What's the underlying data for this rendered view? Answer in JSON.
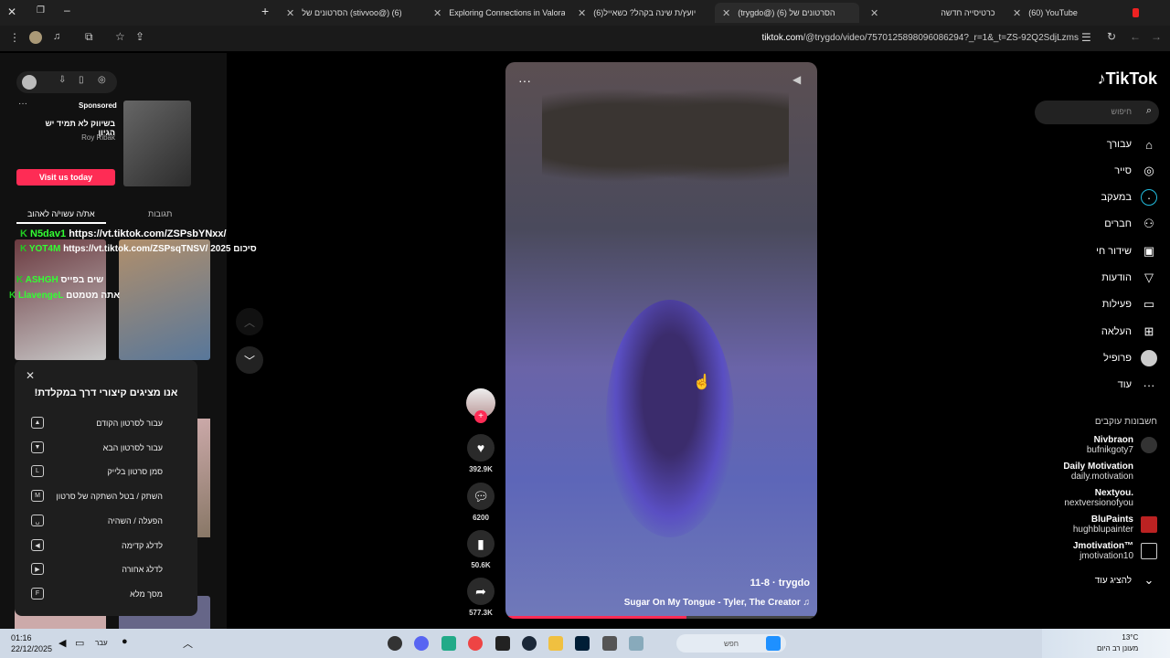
{
  "tabs": [
    {
      "label": "(60) YouTube",
      "color": "#e22"
    },
    {
      "label": "כרטיסייה חדשה",
      "color": "#fff"
    },
    {
      "label": "(trygdo@) הסרטונים של (6)",
      "color": "#111"
    },
    {
      "label": "(6)יועץ/ת שינה בקהל? כשאייל",
      "color": "#111"
    },
    {
      "label": "Exploring Connections in Valorant",
      "color": "#111"
    },
    {
      "label": "הסרטונים של (stivvoo@) (6)",
      "color": "#111"
    }
  ],
  "address": {
    "host": "tiktok.com",
    "path": "/@trygdo/video/7570125898096086294?_r=1&_t=ZS-92Q2SdjLzms"
  },
  "left_panel": {
    "sponsored": "Sponsored",
    "ad_text": "בשיווק לא תמיד יש הגיון",
    "ad_author": "Roy Ribak",
    "ad_button": "Visit us today",
    "tab_liked": "את/ה עשוי/ה לאהוב",
    "tab_comments": "תגובות",
    "chat": [
      {
        "user": "N5dav1",
        "text": "https://vt.tiktok.com/ZSPsbYNxx/"
      },
      {
        "user": "YOT4M",
        "text": "https://vt.tiktok.com/ZSPsqTNSV/ 2025 סיכום"
      },
      {
        "user": "ASHGH",
        "text": "שים בפייס"
      },
      {
        "user": "LlavengeL",
        "text": "אתה מטמטם"
      }
    ]
  },
  "shortcuts": {
    "title": "!אנו מציגים קיצורי דרך במקלדת",
    "items": [
      {
        "key": "▲",
        "label": "עבור לסרטון הקודם"
      },
      {
        "key": "▼",
        "label": "עבור לסרטון הבא"
      },
      {
        "key": "L",
        "label": "סמן סרטון בלייק"
      },
      {
        "key": "M",
        "label": "השתק / בטל השתקה של סרטון"
      },
      {
        "key": "␣",
        "label": "הפעלה / השהיה"
      },
      {
        "key": "◀",
        "label": "לדלג קדימה"
      },
      {
        "key": "▶",
        "label": "לדלג אחורה"
      },
      {
        "key": "F",
        "label": "מסך מלא"
      }
    ]
  },
  "video": {
    "author": "trygdo",
    "date": "11-8",
    "music": "Sugar On My Tongue - Tyler, The Creator",
    "progress": 0.58
  },
  "actions": {
    "likes": "392.9K",
    "comments": "6200",
    "saves": "50.6K",
    "shares": "577.3K"
  },
  "sidebar": {
    "logo": "TikTok",
    "search_placeholder": "חיפוש",
    "nav": [
      {
        "label": "עבורך",
        "icon": "home-icon"
      },
      {
        "label": "סייר",
        "icon": "compass-icon"
      },
      {
        "label": "במעקב",
        "icon": "following-icon"
      },
      {
        "label": "חברים",
        "icon": "friends-icon"
      },
      {
        "label": "שידור חי",
        "icon": "live-icon"
      },
      {
        "label": "הודעות",
        "icon": "messages-icon"
      },
      {
        "label": "פעילות",
        "icon": "activity-icon"
      },
      {
        "label": "העלאה",
        "icon": "upload-icon"
      },
      {
        "label": "פרופיל",
        "icon": "profile-icon"
      },
      {
        "label": "עוד",
        "icon": "more-icon"
      }
    ],
    "following_title": "חשבונות עוקבים",
    "following": [
      {
        "name": "Nivbraon",
        "handle": "bufnikgoty7"
      },
      {
        "name": "Daily Motivation",
        "handle": "daily.motivation"
      },
      {
        "name": "Nextyou.",
        "handle": "nextversionofyou"
      },
      {
        "name": "BluPaints",
        "handle": "hughblupainter"
      },
      {
        "name": "Jmotivation™",
        "handle": "jmotivation10"
      }
    ],
    "show_more": "להציג עוד"
  },
  "taskbar": {
    "time": "01:16",
    "date": "22/12/2025",
    "lang": "עבר",
    "weather": "13°C",
    "weather_text": "מעונן רב היום",
    "search": "חפש"
  }
}
